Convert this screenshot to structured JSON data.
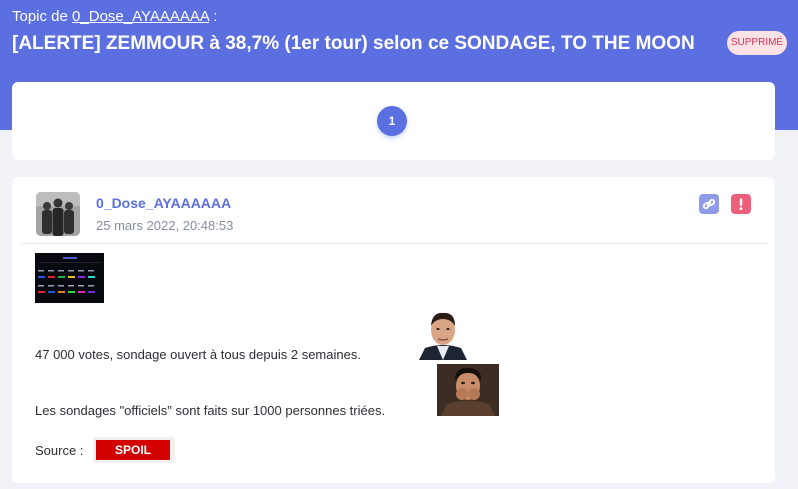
{
  "header": {
    "topic_prefix": "Topic de",
    "author_link": "0_Dose_AYAAAAAA",
    "topic_suffix": ":",
    "title": "[ALERTE] ZEMMOUR à 38,7% (1er tour) selon ce SONDAGE, TO THE MOON",
    "status_badge": "SUPPRIMÉ"
  },
  "pagination": {
    "current_page": "1"
  },
  "post": {
    "author": "0_Dose_AYAAAAAA",
    "date": "25 mars 2022, 20:48:53",
    "lines": [
      "47 000 votes, sondage ouvert à tous depuis 2 semaines.",
      "Les sondages \"officiels\" sont faits sur 1000 personnes triées."
    ],
    "source_label": "Source :",
    "spoil_label": "SPOIL"
  },
  "colors": {
    "accent": "#5c6fe1",
    "badge_bg": "#fde2e6",
    "badge_text": "#d53655",
    "report": "#ee5f7c",
    "spoil": "#d20000"
  },
  "icons": [
    "link-icon",
    "alert-icon"
  ]
}
